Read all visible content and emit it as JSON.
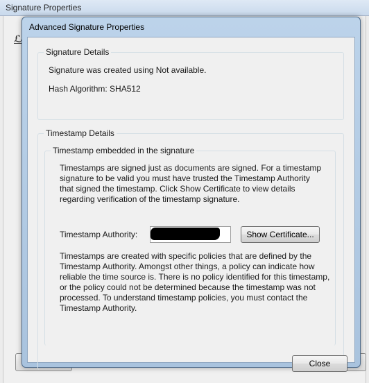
{
  "background_window": {
    "title": "Signature Properties"
  },
  "dialog": {
    "title": "Advanced Signature Properties",
    "signature_details": {
      "heading": "Signature Details",
      "created_text": "Signature was created using Not available.",
      "hash_text": "Hash Algorithm: SHA512"
    },
    "timestamp_details": {
      "heading": "Timestamp Details",
      "embedded_heading": "Timestamp embedded in the signature",
      "description": "Timestamps are signed just as documents are signed. For a timestamp signature to be valid you must have trusted the Timestamp Authority that signed the timestamp. Click Show Certificate to view details regarding verification of the timestamp signature.",
      "authority_label": "Timestamp Authority:",
      "authority_value": "",
      "show_certificate_label": "Show Certificate...",
      "policy_text": "Timestamps are created with specific policies that are defined by the Timestamp Authority. Amongst other things, a policy can indicate how reliable the time source is. There is no policy identified for this timestamp, or the policy could not be determined because the timestamp was not processed. To understand timestamp policies, you must contact the Timestamp Authority."
    },
    "close_label": "Close"
  },
  "colors": {
    "dialog_frame": "#bcd3ea",
    "dialog_client": "#f0f0f0",
    "redaction": "#000000"
  }
}
